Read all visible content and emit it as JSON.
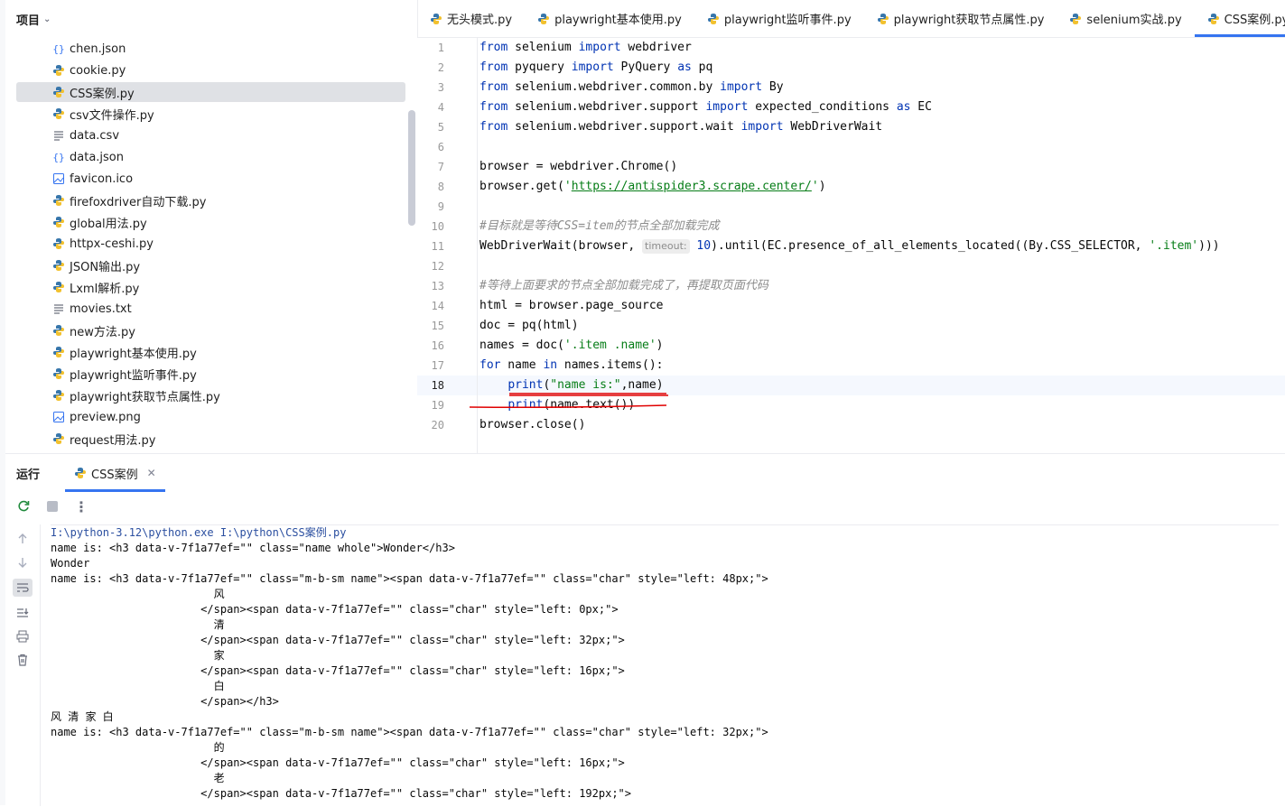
{
  "project": {
    "title": "项目",
    "files": [
      {
        "name": "chen.json",
        "type": "json"
      },
      {
        "name": "cookie.py",
        "type": "py"
      },
      {
        "name": "CSS案例.py",
        "type": "py",
        "selected": true
      },
      {
        "name": "csv文件操作.py",
        "type": "py"
      },
      {
        "name": "data.csv",
        "type": "txt"
      },
      {
        "name": "data.json",
        "type": "json"
      },
      {
        "name": "favicon.ico",
        "type": "img"
      },
      {
        "name": "firefoxdriver自动下载.py",
        "type": "py"
      },
      {
        "name": "global用法.py",
        "type": "py"
      },
      {
        "name": "httpx-ceshi.py",
        "type": "py"
      },
      {
        "name": "JSON输出.py",
        "type": "py"
      },
      {
        "name": "Lxml解析.py",
        "type": "py"
      },
      {
        "name": "movies.txt",
        "type": "txt"
      },
      {
        "name": "new方法.py",
        "type": "py"
      },
      {
        "name": "playwright基本使用.py",
        "type": "py"
      },
      {
        "name": "playwright监听事件.py",
        "type": "py"
      },
      {
        "name": "playwright获取节点属性.py",
        "type": "py"
      },
      {
        "name": "preview.png",
        "type": "img"
      },
      {
        "name": "request用法.py",
        "type": "py"
      }
    ]
  },
  "tabs": [
    {
      "label": "无头模式.py"
    },
    {
      "label": "playwright基本使用.py"
    },
    {
      "label": "playwright监听事件.py"
    },
    {
      "label": "playwright获取节点属性.py"
    },
    {
      "label": "selenium实战.py"
    },
    {
      "label": "CSS案例.py",
      "active": true
    }
  ],
  "editor": {
    "current_line": 18,
    "lines": [
      [
        [
          "kw",
          "from"
        ],
        [
          "t",
          " selenium "
        ],
        [
          "kw",
          "import"
        ],
        [
          "t",
          " webdriver"
        ]
      ],
      [
        [
          "kw",
          "from"
        ],
        [
          "t",
          " pyquery "
        ],
        [
          "kw",
          "import"
        ],
        [
          "t",
          " PyQuery "
        ],
        [
          "kw",
          "as"
        ],
        [
          "t",
          " pq"
        ]
      ],
      [
        [
          "kw",
          "from"
        ],
        [
          "t",
          " selenium.webdriver.common.by "
        ],
        [
          "kw",
          "import"
        ],
        [
          "t",
          " By"
        ]
      ],
      [
        [
          "kw",
          "from"
        ],
        [
          "t",
          " selenium.webdriver.support "
        ],
        [
          "kw",
          "import"
        ],
        [
          "t",
          " expected_conditions "
        ],
        [
          "kw",
          "as"
        ],
        [
          "t",
          " EC"
        ]
      ],
      [
        [
          "kw",
          "from"
        ],
        [
          "t",
          " selenium.webdriver.support.wait "
        ],
        [
          "kw",
          "import"
        ],
        [
          "t",
          " WebDriverWait"
        ]
      ],
      [],
      [
        [
          "t",
          "browser = webdriver.Chrome()"
        ]
      ],
      [
        [
          "t",
          "browser.get("
        ],
        [
          "str",
          "'"
        ],
        [
          "url",
          "https://antispider3.scrape.center/"
        ],
        [
          "str",
          "'"
        ],
        [
          "t",
          ")"
        ]
      ],
      [],
      [
        [
          "cmt",
          "#目标就是等待CSS=item的节点全部加载完成"
        ]
      ],
      [
        [
          "t",
          "WebDriverWait(browser, "
        ],
        [
          "hint",
          "timeout:"
        ],
        [
          "t",
          " "
        ],
        [
          "kw",
          "10"
        ],
        [
          "t",
          ").until(EC.presence_of_all_elements_located((By.CSS_SELECTOR, "
        ],
        [
          "str",
          "'.item'"
        ],
        [
          "t",
          ")))"
        ]
      ],
      [],
      [
        [
          "cmt",
          "#等待上面要求的节点全部加载完成了，再提取页面代码"
        ]
      ],
      [
        [
          "t",
          "html = browser.page_source"
        ]
      ],
      [
        [
          "t",
          "doc = pq(html)"
        ]
      ],
      [
        [
          "t",
          "names = doc("
        ],
        [
          "str",
          "'.item .name'"
        ],
        [
          "t",
          ")"
        ]
      ],
      [
        [
          "kw",
          "for"
        ],
        [
          "t",
          " name "
        ],
        [
          "kw",
          "in"
        ],
        [
          "t",
          " names.items():"
        ]
      ],
      [
        [
          "t",
          "    "
        ],
        [
          "kw",
          "print"
        ],
        [
          "t",
          "("
        ],
        [
          "str",
          "\"name is:\""
        ],
        [
          "t",
          ",name)"
        ]
      ],
      [
        [
          "t",
          "    "
        ],
        [
          "kw",
          "print"
        ],
        [
          "t",
          "(name.text())"
        ]
      ],
      [
        [
          "t",
          "browser.close()"
        ]
      ]
    ]
  },
  "run": {
    "title": "运行",
    "tab_label": "CSS案例",
    "output": [
      "I:\\python-3.12\\python.exe I:\\python\\CSS案例.py",
      "name is: <h3 data-v-7f1a77ef=\"\" class=\"name whole\">Wonder</h3>",
      "Wonder",
      "name is: <h3 data-v-7f1a77ef=\"\" class=\"m-b-sm name\"><span data-v-7f1a77ef=\"\" class=\"char\" style=\"left: 48px;\">",
      "                         风",
      "                       </span><span data-v-7f1a77ef=\"\" class=\"char\" style=\"left: 0px;\">",
      "                         清",
      "                       </span><span data-v-7f1a77ef=\"\" class=\"char\" style=\"left: 32px;\">",
      "                         家",
      "                       </span><span data-v-7f1a77ef=\"\" class=\"char\" style=\"left: 16px;\">",
      "                         白",
      "                       </span></h3>",
      "风 清 家 白",
      "name is: <h3 data-v-7f1a77ef=\"\" class=\"m-b-sm name\"><span data-v-7f1a77ef=\"\" class=\"char\" style=\"left: 32px;\">",
      "                         的",
      "                       </span><span data-v-7f1a77ef=\"\" class=\"char\" style=\"left: 16px;\">",
      "                         老",
      "                       </span><span data-v-7f1a77ef=\"\" class=\"char\" style=\"left: 192px;\">"
    ]
  },
  "colors": {
    "accent": "#3574f0",
    "selection": "#dfe1e5",
    "annotation": "#e00000",
    "python_blue": "#3776ab",
    "python_yellow": "#f2c12e"
  }
}
